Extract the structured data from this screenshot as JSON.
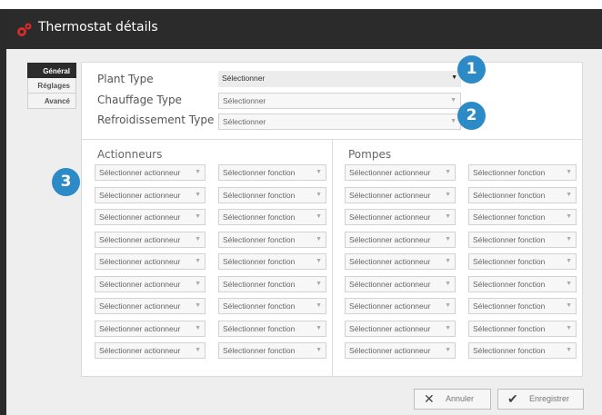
{
  "window": {
    "title": "Thermostat détails",
    "icon": "gears-icon",
    "accent": "#2c8bc7"
  },
  "tabs": [
    "Général",
    "Réglages",
    "Avancé"
  ],
  "form": {
    "rows": [
      {
        "label": "Plant Type",
        "value": "Sélectionner"
      },
      {
        "label": "Chauffage Type",
        "value": "Sélectionner"
      },
      {
        "label": "Refroidissement Type",
        "value": "Sélectionner"
      }
    ]
  },
  "sections": {
    "actionneurs": "Actionneurs",
    "pompes": "Pompes"
  },
  "grid": {
    "actuator_placeholder": "Sélectionner actionneur",
    "function_placeholder": "Sélectionner fonction",
    "rows": 9
  },
  "badges": [
    "1",
    "2",
    "3"
  ],
  "buttons": {
    "cancel": "Annuler",
    "save": "Enregistrer"
  }
}
